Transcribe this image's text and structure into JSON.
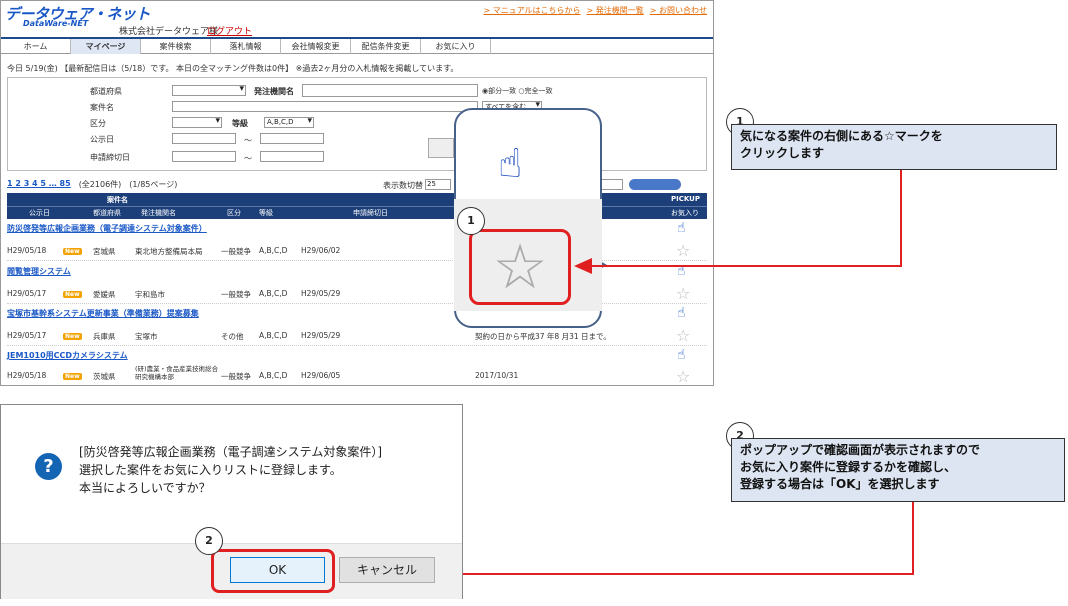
{
  "header": {
    "logo": "データウェア・ネット",
    "logo_sub": "DataWare-NET",
    "company": "株式会社データウェア様",
    "logout": "ログアウト",
    "links": [
      "マニュアルはこちらから",
      "発注機関一覧",
      "お問い合わせ"
    ]
  },
  "tabs": [
    "ホーム",
    "マイページ",
    "案件検索",
    "落札情報",
    "会社情報変更",
    "配信条件変更",
    "お気に入り"
  ],
  "info_line": "今日 5/19(金) 【最新配信日は（5/18）です。 本日の全マッチング件数は0件】 ※過去2ヶ月分の入札情報を掲載しています。",
  "search": {
    "labels": [
      "都道府県",
      "案件名",
      "区分",
      "公示日",
      "申請締切日"
    ],
    "agency_label": "発注機関名",
    "grade_label": "等級",
    "grade_value": "A,B,C,D",
    "tilde": "～",
    "match_options": "◉部分一致 ○完全一致",
    "include_value": "すべてを含む"
  },
  "pager": {
    "pages": "1 2 3 4 5 … 85",
    "total": "(全2106件)",
    "page_of": "(1/85ページ)",
    "per_page_label": "表示数切替",
    "per_page_value": "25"
  },
  "table": {
    "headers": {
      "anken": "案件名",
      "pickup": "PICKUP",
      "kouji": "公示日",
      "pref": "都道府県",
      "agency": "発注機関名",
      "kubun": "区分",
      "grade": "等級",
      "deadline": "申請締切日",
      "fav": "お気入り"
    },
    "rows": [
      {
        "title": "防災啓発等広報企画業務（電子調達システム対象案件）",
        "date": "H29/05/18",
        "pref": "宮城県",
        "agency": "東北地方整備局本局",
        "kubun": "一般競争",
        "grade": "A,B,C,D",
        "deadline": "H29/06/02",
        "extra": ""
      },
      {
        "title": "閲覧管理システム",
        "date": "H29/05/17",
        "pref": "愛媛県",
        "agency": "宇和島市",
        "kubun": "一般競争",
        "grade": "A,B,C,D",
        "deadline": "H29/05/29",
        "extra": ""
      },
      {
        "title": "宝塚市基幹系システム更新事業（準備業務）提案募集",
        "date": "H29/05/17",
        "pref": "兵庫県",
        "agency": "宝塚市",
        "kubun": "その他",
        "grade": "A,B,C,D",
        "deadline": "H29/05/29",
        "extra": "契約の日から平成37 年8 月31 日まで。"
      },
      {
        "title": "JEM1010用CCDカメラシステム",
        "date": "H29/05/18",
        "pref": "茨城県",
        "agency": "(研)農業・食品産業技術総合研究機構本部",
        "kubun": "一般競争",
        "grade": "A,B,C,D",
        "deadline": "H29/06/05",
        "extra": "2017/10/31"
      }
    ],
    "new_badge": "New"
  },
  "callouts": {
    "step1_num": "1",
    "step1_text_a": "気になる案件の右側にある☆マークを",
    "step1_text_b": "クリックします",
    "step2_num": "2",
    "step2_text_a": "ポップアップで確認画面が表示されますので",
    "step2_text_b": "お気に入り案件に登録するかを確認し、",
    "step2_text_c": "登録する場合は「OK」を選択します"
  },
  "dialog": {
    "line1": "[防災啓発等広報企画業務（電子調達システム対象案件）]",
    "line2": "選択した案件をお気に入りリストに登録します。",
    "line3": "本当によろしいですか？",
    "ok": "OK",
    "cancel": "キャンセル"
  },
  "colors": {
    "accent": "#1c3f7a",
    "highlight": "#e02020",
    "note_bg": "#dde5f2"
  }
}
